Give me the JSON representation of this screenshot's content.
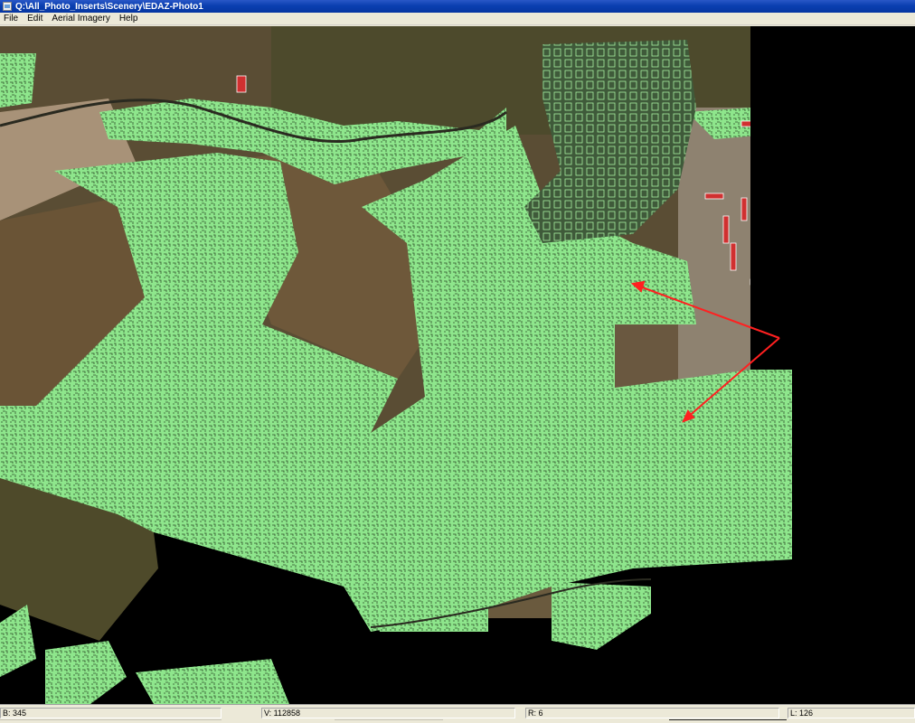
{
  "window": {
    "title": "Q:\\All_Photo_Inserts\\Scenery\\EDAZ-Photo1"
  },
  "menu": {
    "items": [
      {
        "label": "File"
      },
      {
        "label": "Edit"
      },
      {
        "label": "Aerial Imagery"
      },
      {
        "label": "Help"
      }
    ]
  },
  "status": {
    "b": "B: 345",
    "v": "V: 112858",
    "r": "R: 6",
    "l": "L: 126"
  },
  "colors": {
    "title_bar": "#0a3fb0",
    "vegetation_fill": "#8ee68c",
    "annotation_arrow": "#ff2020",
    "background": "#000000"
  },
  "icons": {
    "window_icon": "app-window-icon",
    "arrow": "red-arrow-annotation"
  }
}
